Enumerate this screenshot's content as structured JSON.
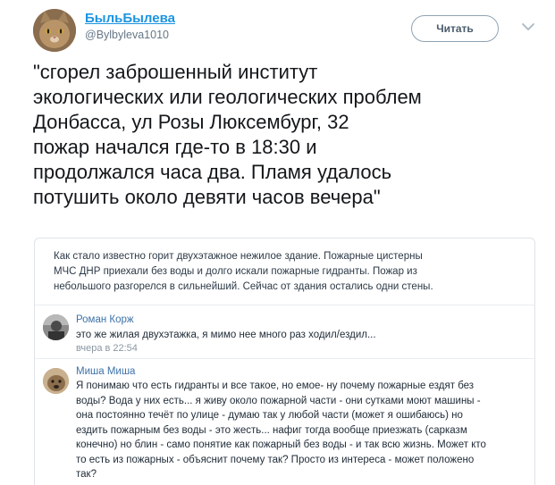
{
  "user": {
    "display_name": "БыльБылева",
    "handle": "@Bylbyleva1010"
  },
  "follow_label": "Читать",
  "tweet_lines": [
    "\"сгорел заброшенный институт",
    "экологических или геологических проблем",
    "Донбасса, ул Розы Люксембург, 32",
    "пожар начался где-то в 18:30 и",
    "продолжался часа два. Пламя удалось",
    "потушить около девяти часов вечера\""
  ],
  "embedded_post": {
    "lines": [
      "Как стало известно горит двухэтажное нежилое здание. Пожарные цистерны",
      "МЧС ДНР приехали без воды и долго искали пожарные гидранты. Пожар из",
      "небольшого разгорелся в сильнейший. Сейчас от здания остались одни стены."
    ]
  },
  "comments": [
    {
      "author": "Роман Корж",
      "lines": [
        "это же жилая двухэтажка, я мимо нее много раз ходил/ездил..."
      ],
      "time": "вчера в 22:54"
    },
    {
      "author": "Миша Миша",
      "lines": [
        "Я понимаю что есть гидранты и все такое, но емое- ну почему пожарные ездят без",
        "воды? Вода у них есть... я живу около пожарной части - они сутками моют машины -",
        "она постоянно течёт по улице - думаю так у любой части (может я ошибаюсь) но",
        "ездить пожарным без воды - это жесть... нафиг тогда вообще приезжать (сарказм",
        "конечно) но блин - само понятие как пожарный без воды - и так всю жизнь. Может кто",
        "то есть из пожарных - объяснит почему так? Просто из интереса - может положено",
        "так?"
      ]
    }
  ],
  "colors": {
    "name_link": "#1c94e0",
    "comment_author": "#3e72a8"
  }
}
